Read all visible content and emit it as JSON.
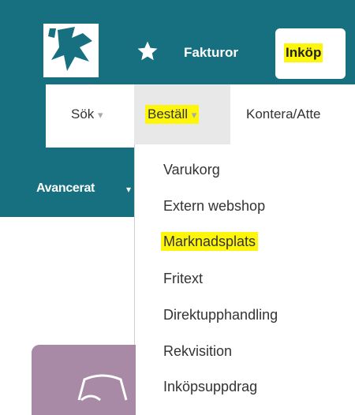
{
  "header": {
    "top_links": [
      {
        "label": "Fakturor"
      },
      {
        "label": "Inköp",
        "highlighted": true
      }
    ],
    "icons": [
      "logo-icon",
      "star-icon"
    ]
  },
  "subnav": {
    "items": [
      {
        "label": "Sök"
      },
      {
        "label": "Beställ",
        "active": true,
        "highlighted": true
      },
      {
        "label": "Kontera/Atte"
      }
    ],
    "caret": "▾"
  },
  "secondary": {
    "label": "Avancerat"
  },
  "dropdown": {
    "items": [
      {
        "label": "Varukorg"
      },
      {
        "label": "Extern webshop"
      },
      {
        "label": "Marknadsplats",
        "highlighted": true
      },
      {
        "label": "Fritext"
      },
      {
        "label": "Direktupphandling"
      },
      {
        "label": "Rekvisition"
      },
      {
        "label": "Inköpsuppdrag"
      }
    ]
  },
  "colors": {
    "header_bg": "#16707f",
    "highlight": "#fdf50a",
    "card_bg": "#a88aa6"
  }
}
